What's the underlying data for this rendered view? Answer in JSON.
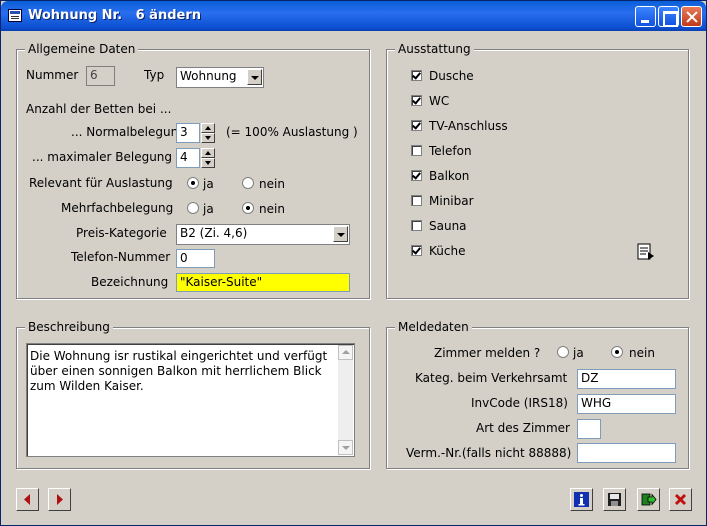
{
  "window": {
    "title": "Wohnung Nr.   6 ändern"
  },
  "general": {
    "title": "Allgemeine Daten",
    "nummer_label": "Nummer",
    "nummer_value": "6",
    "typ_label": "Typ",
    "typ_value": "Wohnung",
    "betten_heading": "Anzahl der Betten bei ...",
    "normal_label": "... Normalbelegung",
    "normal_value": "3",
    "normal_note": "(= 100% Auslastung )",
    "max_label": "... maximaler Belegung",
    "max_value": "4",
    "relevant_label": "Relevant für Auslastung",
    "relevant_ja": "ja",
    "relevant_nein": "nein",
    "mehrfach_label": "Mehrfachbelegung",
    "mehrfach_ja": "ja",
    "mehrfach_nein": "nein",
    "preis_label": "Preis-Kategorie",
    "preis_value": "B2 (Zi. 4,6)",
    "telefon_label": "Telefon-Nummer",
    "telefon_value": "0",
    "bez_label": "Bezeichnung",
    "bez_value": "\"Kaiser-Suite\""
  },
  "ausstattung": {
    "title": "Ausstattung",
    "items": [
      {
        "label": "Dusche",
        "checked": true
      },
      {
        "label": "WC",
        "checked": true
      },
      {
        "label": "TV-Anschluss",
        "checked": true
      },
      {
        "label": "Telefon",
        "checked": false
      },
      {
        "label": "Balkon",
        "checked": true
      },
      {
        "label": "Minibar",
        "checked": false
      },
      {
        "label": "Sauna",
        "checked": false
      },
      {
        "label": "Küche",
        "checked": true
      }
    ]
  },
  "beschreibung": {
    "title": "Beschreibung",
    "text": "Die Wohnung isr rustikal eingerichtet und verfügt\nüber einen sonnigen Balkon mit herrlichem Blick\nzum Wilden Kaiser."
  },
  "meldedaten": {
    "title": "Meldedaten",
    "zimmer_label": "Zimmer melden ?",
    "zimmer_ja": "ja",
    "zimmer_nein": "nein",
    "kateg_label": "Kateg. beim Verkehrsamt",
    "kateg_value": "DZ",
    "invcode_label": "InvCode (IRS18)",
    "invcode_value": "WHG",
    "art_label": "Art des Zimmer",
    "art_value": "",
    "verm_label": "Verm.-Nr.(falls nicht 88888)",
    "verm_value": ""
  }
}
